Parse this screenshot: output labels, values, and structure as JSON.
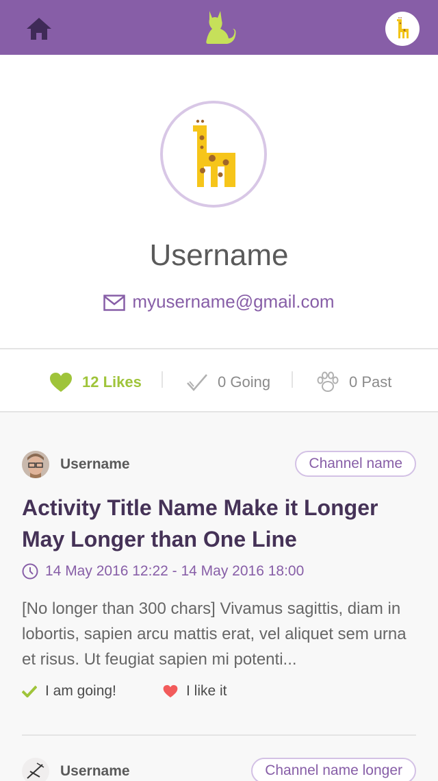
{
  "header": {
    "home_icon": "home-icon",
    "logo_icon": "cat-logo-icon",
    "avatar_icon": "giraffe-avatar-icon",
    "bar_color": "#875ea7"
  },
  "profile": {
    "avatar_icon": "giraffe-avatar-icon",
    "username": "Username",
    "email": "myusername@gmail.com",
    "email_icon": "envelope-icon"
  },
  "stats": {
    "likes": {
      "label": "12 Likes",
      "icon": "heart-icon",
      "color": "#9fc43a"
    },
    "going": {
      "label": "0 Going",
      "icon": "check-icon"
    },
    "past": {
      "label": "0 Past",
      "icon": "paw-icon"
    }
  },
  "feed": [
    {
      "author": "Username",
      "channel": "Channel name",
      "title": "Activity Title Name Make it Longer May Longer than One Line",
      "time": "14 May 2016 12:22 - 14 May 2016 18:00",
      "description": "[No longer than 300 chars] Vivamus sagittis, diam in lobortis, sapien arcu mattis erat, vel aliquet sem urna et risus. Ut feugiat sapien mi potenti...",
      "going_label": "I am going!",
      "like_label": "I like it"
    },
    {
      "author": "Username",
      "channel": "Channel name longer"
    }
  ]
}
